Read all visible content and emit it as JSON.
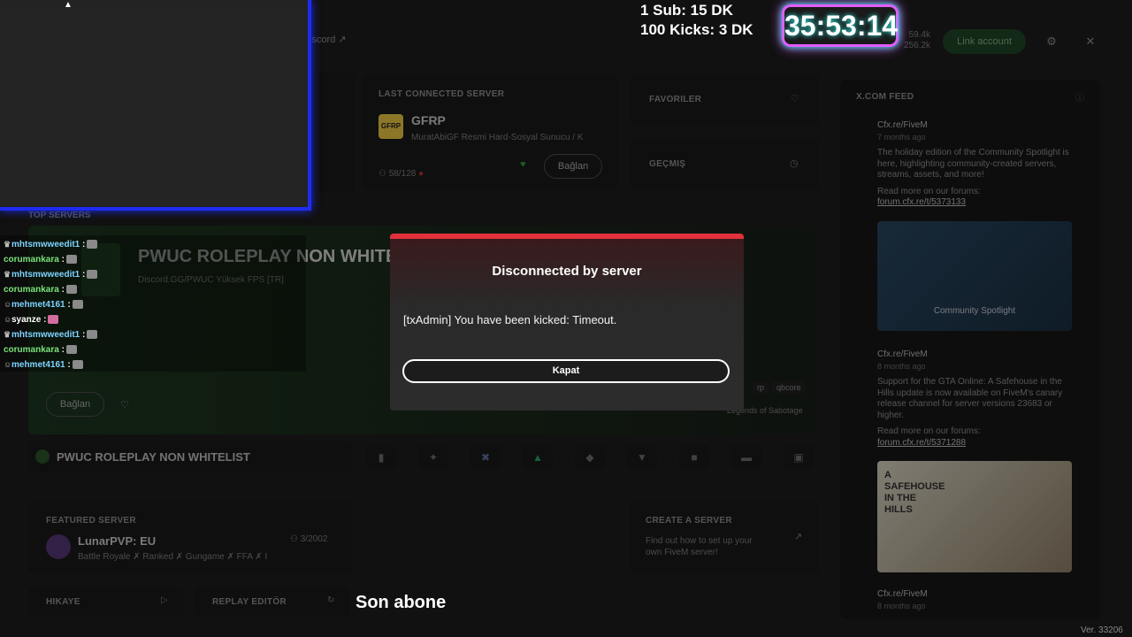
{
  "header": {
    "discord_label": "iscord",
    "player_stats": [
      "59.4k",
      "256.2k"
    ],
    "link_account": "Link account"
  },
  "last_connected": {
    "title": "LAST CONNECTED SERVER",
    "server_name": "GFRP",
    "logo_text": "GFRP",
    "description": "MuratAbiGF Resmi Hard-Sosyal Sunucu / K",
    "players": "58/128",
    "connect": "Bağlan"
  },
  "favoriler": "FAVORILER",
  "gecmis": "GEÇMIŞ",
  "top_servers": {
    "title": "TOP SERVERS",
    "hero_name": "PWUC ROLEPLAY NON WHITE",
    "hero_desc": "Discord.GG/PWUC Yüksek FPS [TR]",
    "connect": "Bağlan",
    "tags": [
      "rp",
      "qbcore"
    ],
    "credit": "Legends of Sabotage",
    "strip_name": "PWUC ROLEPLAY NON WHITELIST"
  },
  "featured": {
    "title": "FEATURED SERVER",
    "name": "LunarPVP: EU",
    "players": "3/2002",
    "desc": "Battle Royale ✗ Ranked ✗ Gungame ✗ FFA ✗ I"
  },
  "create": {
    "title": "CREATE A SERVER",
    "desc1": "Find out how to set up your",
    "desc2": "own FiveM server!"
  },
  "hikaye": "HIKAYE",
  "replay": "REPLAY EDITÖR",
  "feed": {
    "title": "X.COM FEED",
    "items": [
      {
        "author": "Cfx.re/FiveM",
        "date": "7 months ago",
        "text": "The holiday edition of the Community Spotlight is here, highlighting community-created servers, streams, assets, and more!",
        "read": "Read more on our forums:",
        "link": "forum.cfx.re/t/5373133"
      },
      {
        "author": "Cfx.re/FiveM",
        "date": "8 months ago",
        "text": "Support for the GTA Online: A Safehouse in the Hills update is now available on FiveM's canary release channel for server versions 23683 or higher.",
        "read": "Read more on our forums:",
        "link": "forum.cfx.re/t/5371288"
      },
      {
        "author": "Cfx.re/FiveM",
        "date": "8 months ago"
      }
    ],
    "img1_caption": "Community Spotlight",
    "img2_caption": "A SAFEHOUSE IN THE HILLS"
  },
  "overlay": {
    "sub_goal_1": "1 Sub: 15 DK",
    "sub_goal_2": "100 Kicks: 3 DK",
    "timer": "35:53:14",
    "son_abone": "Son abone",
    "chat": [
      {
        "user": "mhtsmwweedit1",
        "color": "#7fd3ff",
        "badge": "♛",
        "emote": true
      },
      {
        "user": "corumankara",
        "color": "#7be37b",
        "badge": "",
        "emote": true
      },
      {
        "user": "mhtsmwweedit1",
        "color": "#7fd3ff",
        "badge": "♛",
        "emote": true
      },
      {
        "user": "corumankara",
        "color": "#7be37b",
        "badge": "",
        "emote": true
      },
      {
        "user": "mehmet4161",
        "color": "#7fd3ff",
        "badge": "☺",
        "emote": true
      },
      {
        "user": "syanze",
        "color": "#ffffff",
        "badge": "☺",
        "emote": true
      },
      {
        "user": "mhtsmwweedit1",
        "color": "#7fd3ff",
        "badge": "♛",
        "emote": true
      },
      {
        "user": "corumankara",
        "color": "#7be37b",
        "badge": "",
        "emote": true
      },
      {
        "user": "mehmet4161",
        "color": "#7fd3ff",
        "badge": "☺",
        "emote": true
      }
    ]
  },
  "modal": {
    "title": "Disconnected by server",
    "message": "[txAdmin] You have been kicked: Timeout.",
    "button": "Kapat"
  },
  "version": "Ver. 33206"
}
